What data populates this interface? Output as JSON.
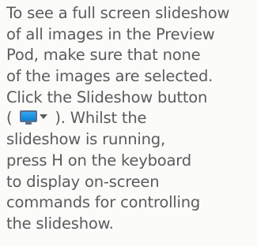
{
  "doc": {
    "lines": [
      "To see a full screen slideshow",
      "of all images in the Preview",
      "Pod, make sure that none",
      "of the images are selected.",
      "Click the Slideshow button"
    ],
    "line6_before": "( ",
    "line6_after": " ). Whilst the",
    "lines_end": [
      "slideshow is running,",
      "press H on the keyboard",
      "to display on-screen",
      "commands for controlling",
      "the slideshow."
    ]
  },
  "icons": {
    "slideshow": "monitor-slideshow-icon",
    "dropdown": "chevron-down-icon"
  },
  "colors": {
    "text": "#5b5b5b",
    "background": "#fbfbfa",
    "icon_screen": "#1a8fe3"
  }
}
